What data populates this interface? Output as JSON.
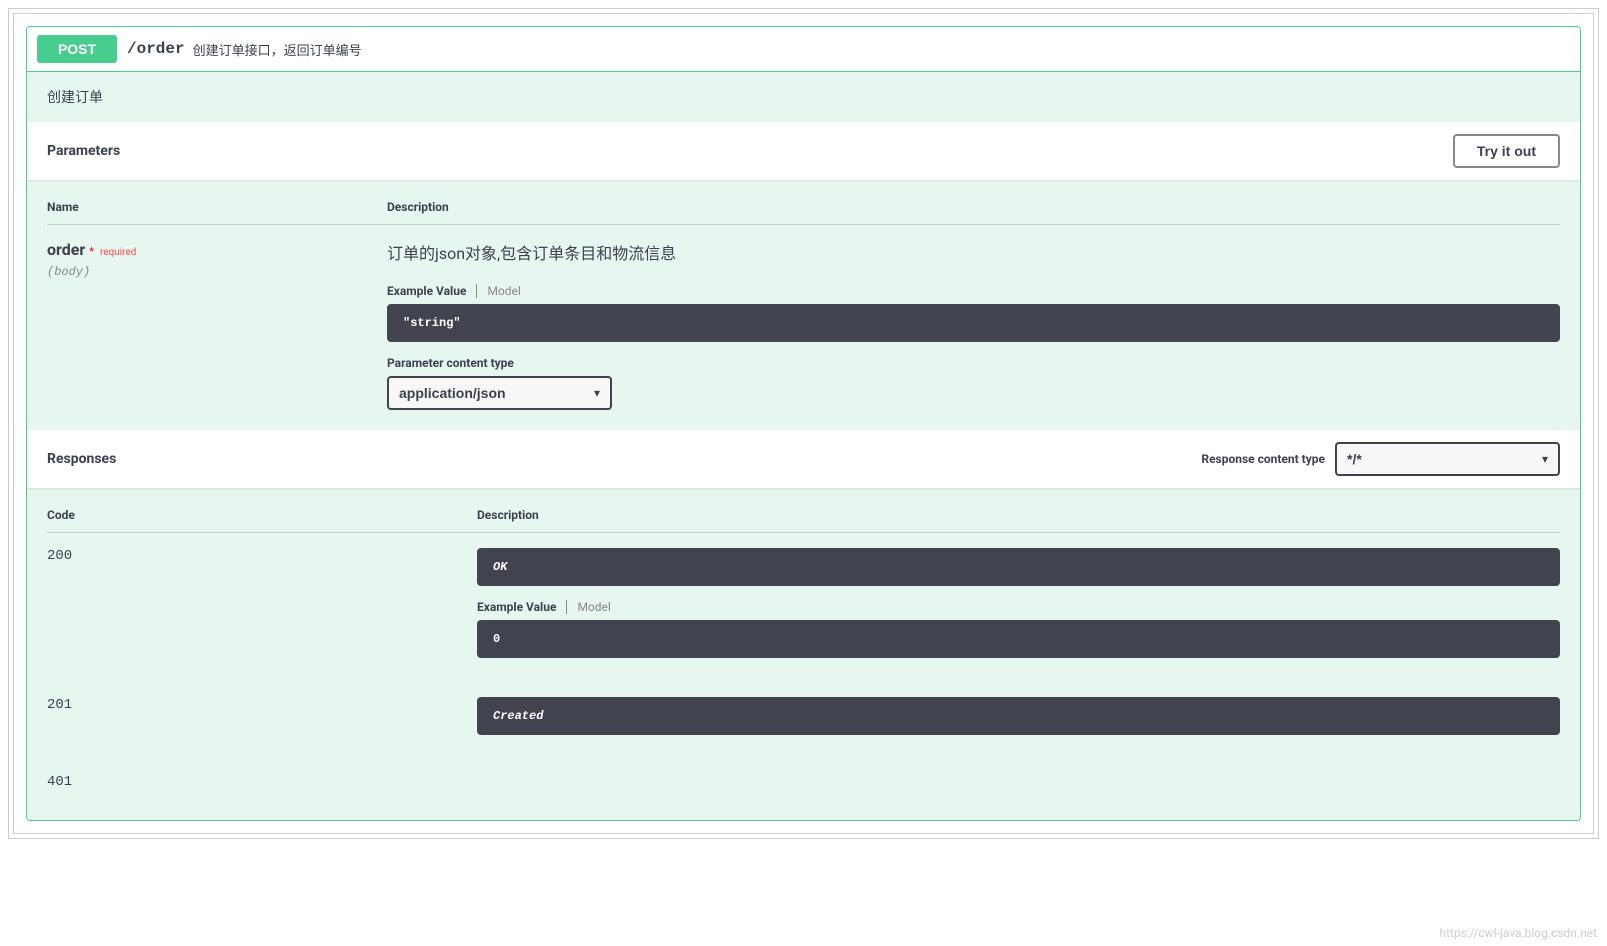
{
  "endpoint": {
    "method": "POST",
    "path": "/order",
    "summary": "创建订单接口，返回订单编号",
    "description": "创建订单"
  },
  "sections": {
    "parameters_title": "Parameters",
    "responses_title": "Responses",
    "try_it_out": "Try it out"
  },
  "param_table": {
    "header_name": "Name",
    "header_desc": "Description"
  },
  "parameter": {
    "name": "order",
    "required_label": "required",
    "in": "(body)",
    "description": "订单的json对象,包含订单条目和物流信息",
    "tabs": {
      "example_value": "Example Value",
      "model": "Model"
    },
    "example": "\"string\"",
    "content_type_label": "Parameter content type",
    "content_type_value": "application/json"
  },
  "response_meta": {
    "content_type_label": "Response content type",
    "content_type_value": "*/*"
  },
  "response_table": {
    "header_code": "Code",
    "header_desc": "Description"
  },
  "responses": {
    "r200": {
      "code": "200",
      "desc": "OK",
      "tabs": {
        "example_value": "Example Value",
        "model": "Model"
      },
      "example": "0"
    },
    "r201": {
      "code": "201",
      "desc": "Created"
    },
    "r401": {
      "code": "401"
    }
  },
  "watermark": "https://cwl-java.blog.csdn.net"
}
